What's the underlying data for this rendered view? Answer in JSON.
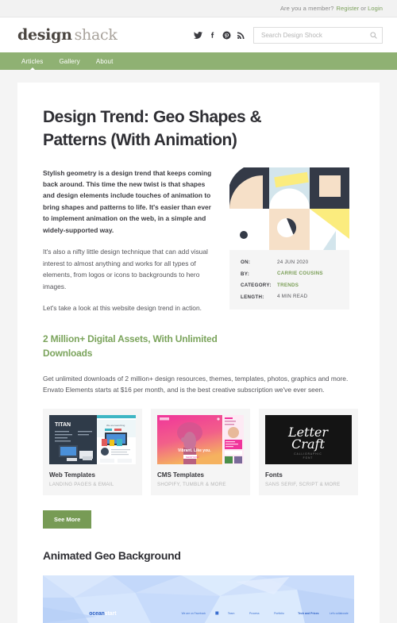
{
  "topbar": {
    "question": "Are you a member?",
    "register": "Register",
    "or": "or",
    "login": "Login"
  },
  "masthead": {
    "logo_primary": "design",
    "logo_secondary": "shack",
    "socials": [
      {
        "name": "twitter-icon"
      },
      {
        "name": "facebook-icon"
      },
      {
        "name": "pinterest-icon"
      },
      {
        "name": "rss-icon"
      }
    ],
    "search_placeholder": "Search Design Shock",
    "search_value": ""
  },
  "nav": {
    "items": [
      {
        "label": "Articles",
        "active": true
      },
      {
        "label": "Gallery",
        "active": false
      },
      {
        "label": "About",
        "active": false
      }
    ]
  },
  "article": {
    "title": "Design Trend: Geo Shapes & Patterns (With Animation)",
    "lead": "Stylish geometry is a design trend that keeps coming back around. This time the new twist is that shapes and design elements include touches of animation to bring shapes and patterns to life. It's easier than ever to implement animation on the web, in a simple and widely-supported way.",
    "paragraph_2": "It's also a nifty little design technique that can add visual interest to almost anything and works for all types of elements, from logos or icons to backgrounds to hero images.",
    "paragraph_3": "Let's take a look at this website design trend in action.",
    "meta": [
      {
        "key": "ON:",
        "value": "24 JUN 2020",
        "accent": false
      },
      {
        "key": "BY:",
        "value": "CARRIE COUSINS",
        "accent": true
      },
      {
        "key": "CATEGORY:",
        "value": "TRENDS",
        "accent": true
      },
      {
        "key": "LENGTH:",
        "value": "4 MIN READ",
        "accent": false
      }
    ]
  },
  "promo": {
    "title": "2 Million+ Digital Assets, With Unlimited Downloads",
    "body": "Get unlimited downloads of 2 million+ design resources, themes, templates, photos, graphics and more. Envato Elements starts at $16 per month, and is the best creative subscription we've ever seen.",
    "cards": [
      {
        "name": "Web Templates",
        "sub": "LANDING PAGES & EMAIL",
        "thumb_label": "TITAN"
      },
      {
        "name": "CMS Templates",
        "sub": "SHOPIFY, TUMBLR & MORE",
        "thumb_label": "Vibrant. Like you."
      },
      {
        "name": "Fonts",
        "sub": "SANS SERIF, SCRIPT & MORE",
        "thumb_label": "Letter Craft"
      }
    ],
    "see_more": "See More"
  },
  "section": {
    "heading": "Animated Geo Background"
  },
  "preview": {
    "brand_first": "ocean",
    "brand_second": "start",
    "links": [
      "We are on Facebook",
      "Team",
      "Process",
      "Portfolio",
      "Tech and Prices",
      "Let's collaborate"
    ]
  },
  "colors": {
    "nav_green": "#8fb173",
    "accent_green": "#7ba45c",
    "button_green": "#779b55",
    "page_bg": "#f4f4f4",
    "geo_dark": "#343a47",
    "geo_yellow": "#fbec7e",
    "geo_peach": "#f6e0c8",
    "geo_blue": "#d3e5ec"
  }
}
